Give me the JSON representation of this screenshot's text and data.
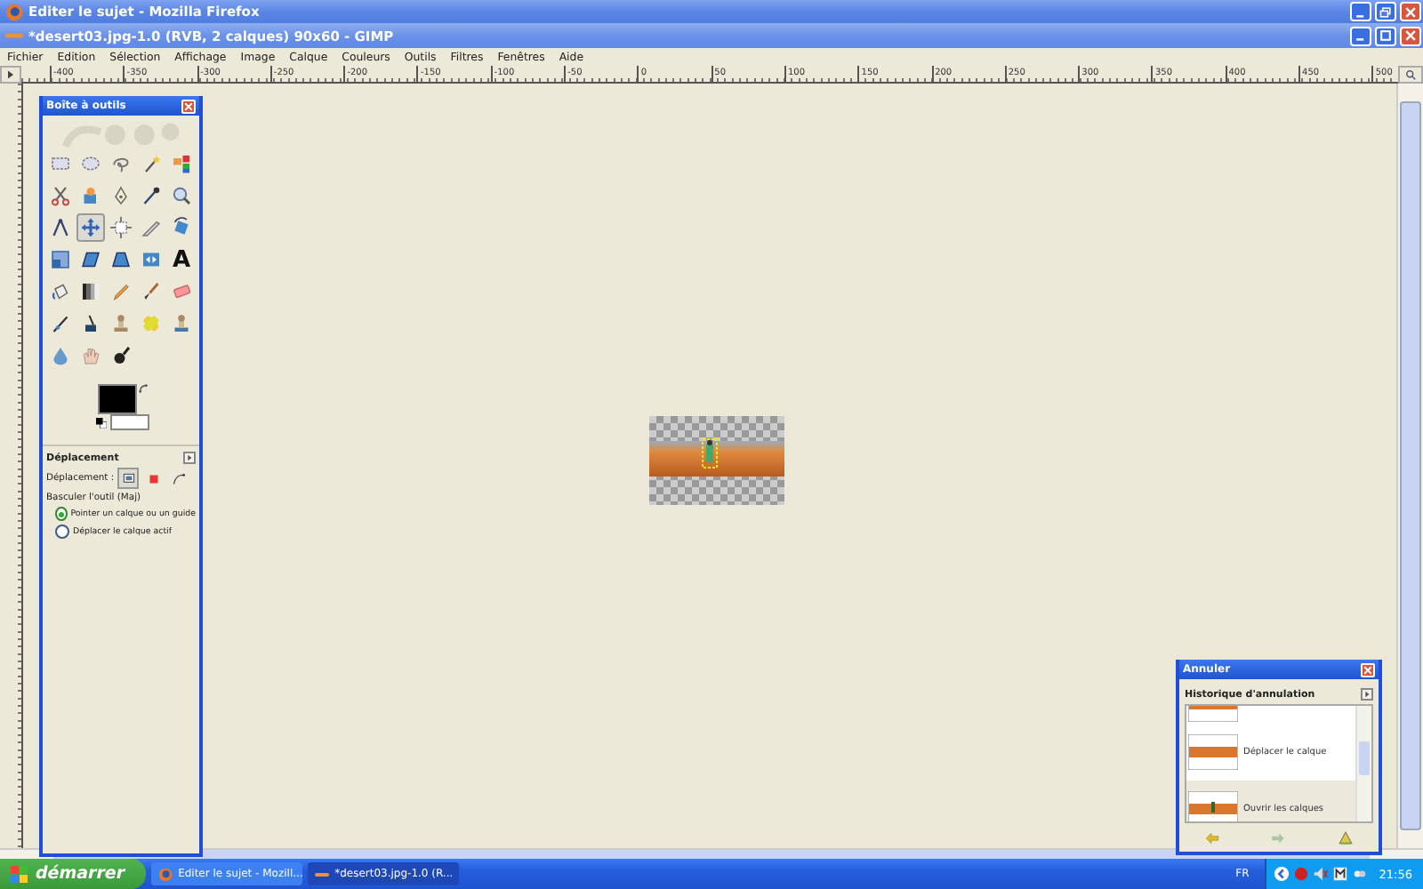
{
  "browser_window": {
    "title": "Editer le sujet - Mozilla Firefox"
  },
  "gimp_window": {
    "title": "*desert03.jpg-1.0 (RVB, 2 calques) 90x60 - GIMP",
    "menu": [
      "Fichier",
      "Edition",
      "Sélection",
      "Affichage",
      "Image",
      "Calque",
      "Couleurs",
      "Outils",
      "Filtres",
      "Fenêtres",
      "Aide"
    ],
    "ruler_labels": [
      "-400",
      "-350",
      "-300",
      "-250",
      "-200",
      "-150",
      "-100",
      "-50",
      "0",
      "50",
      "100",
      "150",
      "200",
      "250",
      "300",
      "350",
      "400",
      "450",
      "500"
    ]
  },
  "toolbox": {
    "title": "Boîte à outils",
    "tools": [
      {
        "kind": "rect",
        "selected": false
      },
      {
        "kind": "ellipse",
        "selected": false
      },
      {
        "kind": "lasso",
        "selected": false
      },
      {
        "kind": "wand",
        "selected": false
      },
      {
        "kind": "colorsel",
        "selected": false
      },
      {
        "kind": "scissors",
        "selected": false
      },
      {
        "kind": "foreground",
        "selected": false
      },
      {
        "kind": "paths",
        "selected": false
      },
      {
        "kind": "picker",
        "selected": false
      },
      {
        "kind": "zoom",
        "selected": false
      },
      {
        "kind": "measure",
        "selected": false
      },
      {
        "kind": "move",
        "selected": true
      },
      {
        "kind": "align",
        "selected": false
      },
      {
        "kind": "crop",
        "selected": false
      },
      {
        "kind": "rotate",
        "selected": false
      },
      {
        "kind": "scale",
        "selected": false
      },
      {
        "kind": "shear",
        "selected": false
      },
      {
        "kind": "perspective",
        "selected": false
      },
      {
        "kind": "flip",
        "selected": false
      },
      {
        "kind": "text",
        "glyph": "A",
        "selected": false
      },
      {
        "kind": "bucket",
        "selected": false
      },
      {
        "kind": "blend",
        "selected": false
      },
      {
        "kind": "pencil",
        "selected": false
      },
      {
        "kind": "brush",
        "selected": false
      },
      {
        "kind": "eraser",
        "selected": false
      },
      {
        "kind": "airbrush",
        "selected": false
      },
      {
        "kind": "ink",
        "selected": false
      },
      {
        "kind": "clone",
        "selected": false
      },
      {
        "kind": "heal",
        "selected": false
      },
      {
        "kind": "pclone",
        "selected": false
      },
      {
        "kind": "blur",
        "selected": false
      },
      {
        "kind": "smudge",
        "selected": false
      },
      {
        "kind": "dodge",
        "selected": false
      }
    ]
  },
  "tool_options": {
    "title": "Déplacement",
    "move_label": "Déplacement :",
    "modes": [
      {
        "kind": "layer",
        "selected": true
      },
      {
        "kind": "selection",
        "selected": false
      },
      {
        "kind": "path",
        "selected": false
      }
    ],
    "toggle_label": "Basculer l'outil  (Maj)",
    "options": [
      {
        "label": "Pointer un calque ou un guide",
        "selected": true
      },
      {
        "label": "Déplacer le calque actif",
        "selected": false
      }
    ]
  },
  "undo_dialog": {
    "title": "Annuler",
    "tab": "Historique d'annulation",
    "items": [
      {
        "kind": "partial",
        "selected": false
      },
      {
        "kind": "step",
        "label": "Déplacer le calque",
        "selected": false
      },
      {
        "kind": "step",
        "label": "Ouvrir les calques",
        "selected": true
      }
    ],
    "buttons": [
      {
        "kind": "undo",
        "disabled": false
      },
      {
        "kind": "redo",
        "disabled": true
      },
      {
        "kind": "clear",
        "disabled": false
      }
    ]
  },
  "taskbar": {
    "start": "démarrer",
    "tasks": [
      {
        "kind": "firefox",
        "label": "Editer le sujet - Mozill...",
        "selected": false
      },
      {
        "kind": "gimp",
        "label": "*desert03.jpg-1.0 (R...",
        "selected": true
      }
    ],
    "language": "FR",
    "clock": "21:56"
  }
}
